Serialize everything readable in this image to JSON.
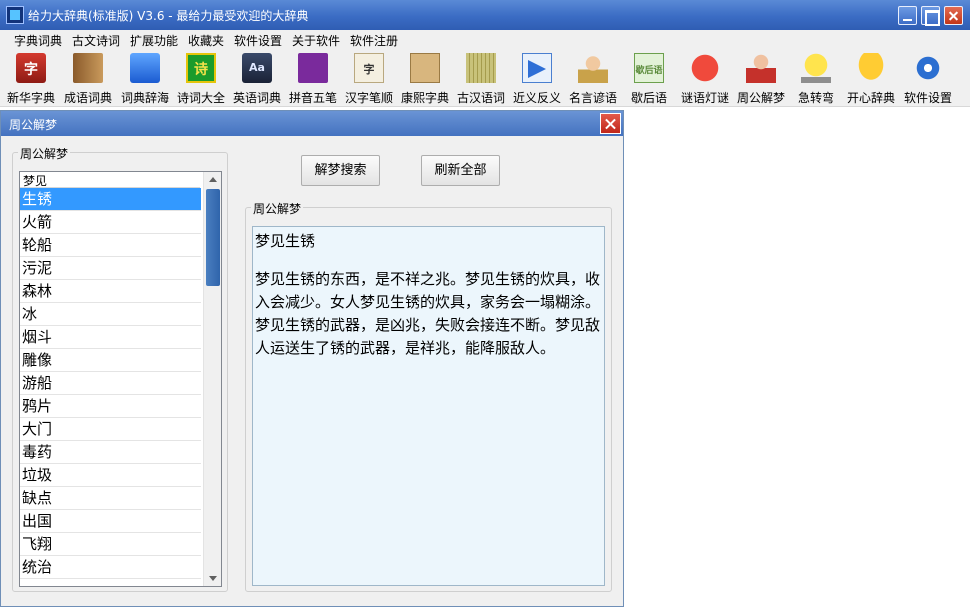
{
  "window": {
    "title": "给力大辞典(标准版) V3.6  -  最给力最受欢迎的大辞典"
  },
  "menu": [
    "字典词典",
    "古文诗词",
    "扩展功能",
    "收藏夹",
    "软件设置",
    "关于软件",
    "软件注册"
  ],
  "toolbar": [
    {
      "label": "新华字典",
      "icon": "dictionary-char-icon",
      "glyph": "字"
    },
    {
      "label": "成语词典",
      "icon": "idiom-book-icon",
      "glyph": ""
    },
    {
      "label": "词典辞海",
      "icon": "word-book-icon",
      "glyph": ""
    },
    {
      "label": "诗词大全",
      "icon": "poem-icon",
      "glyph": "诗"
    },
    {
      "label": "英语词典",
      "icon": "english-dictionary-icon",
      "glyph": "Aa"
    },
    {
      "label": "拼音五笔",
      "icon": "pinyin-wubi-icon",
      "glyph": ""
    },
    {
      "label": "汉字笔顺",
      "icon": "stroke-order-icon",
      "glyph": "字"
    },
    {
      "label": "康熙字典",
      "icon": "kangxi-dictionary-icon",
      "glyph": ""
    },
    {
      "label": "古汉语词",
      "icon": "bamboo-scroll-icon",
      "glyph": ""
    },
    {
      "label": "近义反义",
      "icon": "synonym-icon",
      "glyph": ""
    },
    {
      "label": "名言谚语",
      "icon": "quotes-icon",
      "glyph": ""
    },
    {
      "label": "歇后语",
      "icon": "xiehouyu-icon",
      "glyph": "歇后语"
    },
    {
      "label": "谜语灯谜",
      "icon": "lantern-icon",
      "glyph": ""
    },
    {
      "label": "周公解梦",
      "icon": "zhougong-icon",
      "glyph": ""
    },
    {
      "label": "急转弯",
      "icon": "lightbulb-icon",
      "glyph": ""
    },
    {
      "label": "开心辞典",
      "icon": "cup-icon",
      "glyph": ""
    },
    {
      "label": "软件设置",
      "icon": "gear-icon",
      "glyph": ""
    }
  ],
  "dream": {
    "window_title": "周公解梦",
    "left_group_title": "周公解梦",
    "list_header": "梦见",
    "items": [
      "生锈",
      "火箭",
      "轮船",
      "污泥",
      "森林",
      "冰",
      "烟斗",
      "雕像",
      "游船",
      "鸦片",
      "大门",
      "毒药",
      "垃圾",
      "缺点",
      "出国",
      "飞翔",
      "统治"
    ],
    "selected_index": 0,
    "search_label": "解梦搜索",
    "refresh_label": "刷新全部",
    "result_group_title": "周公解梦",
    "result_heading": "梦见生锈",
    "result_text": "梦见生锈的东西，是不祥之兆。梦见生锈的炊具，收入会减少。女人梦见生锈的炊具，家务会一塌糊涂。梦见生锈的武器，是凶兆，失败会接连不断。梦见敌人运送生了锈的武器，是祥兆，能降服敌人。"
  },
  "colors": {
    "titlebar": "#3b6cc4",
    "selection": "#3399ff",
    "result_bg": "#ecf6fc"
  }
}
